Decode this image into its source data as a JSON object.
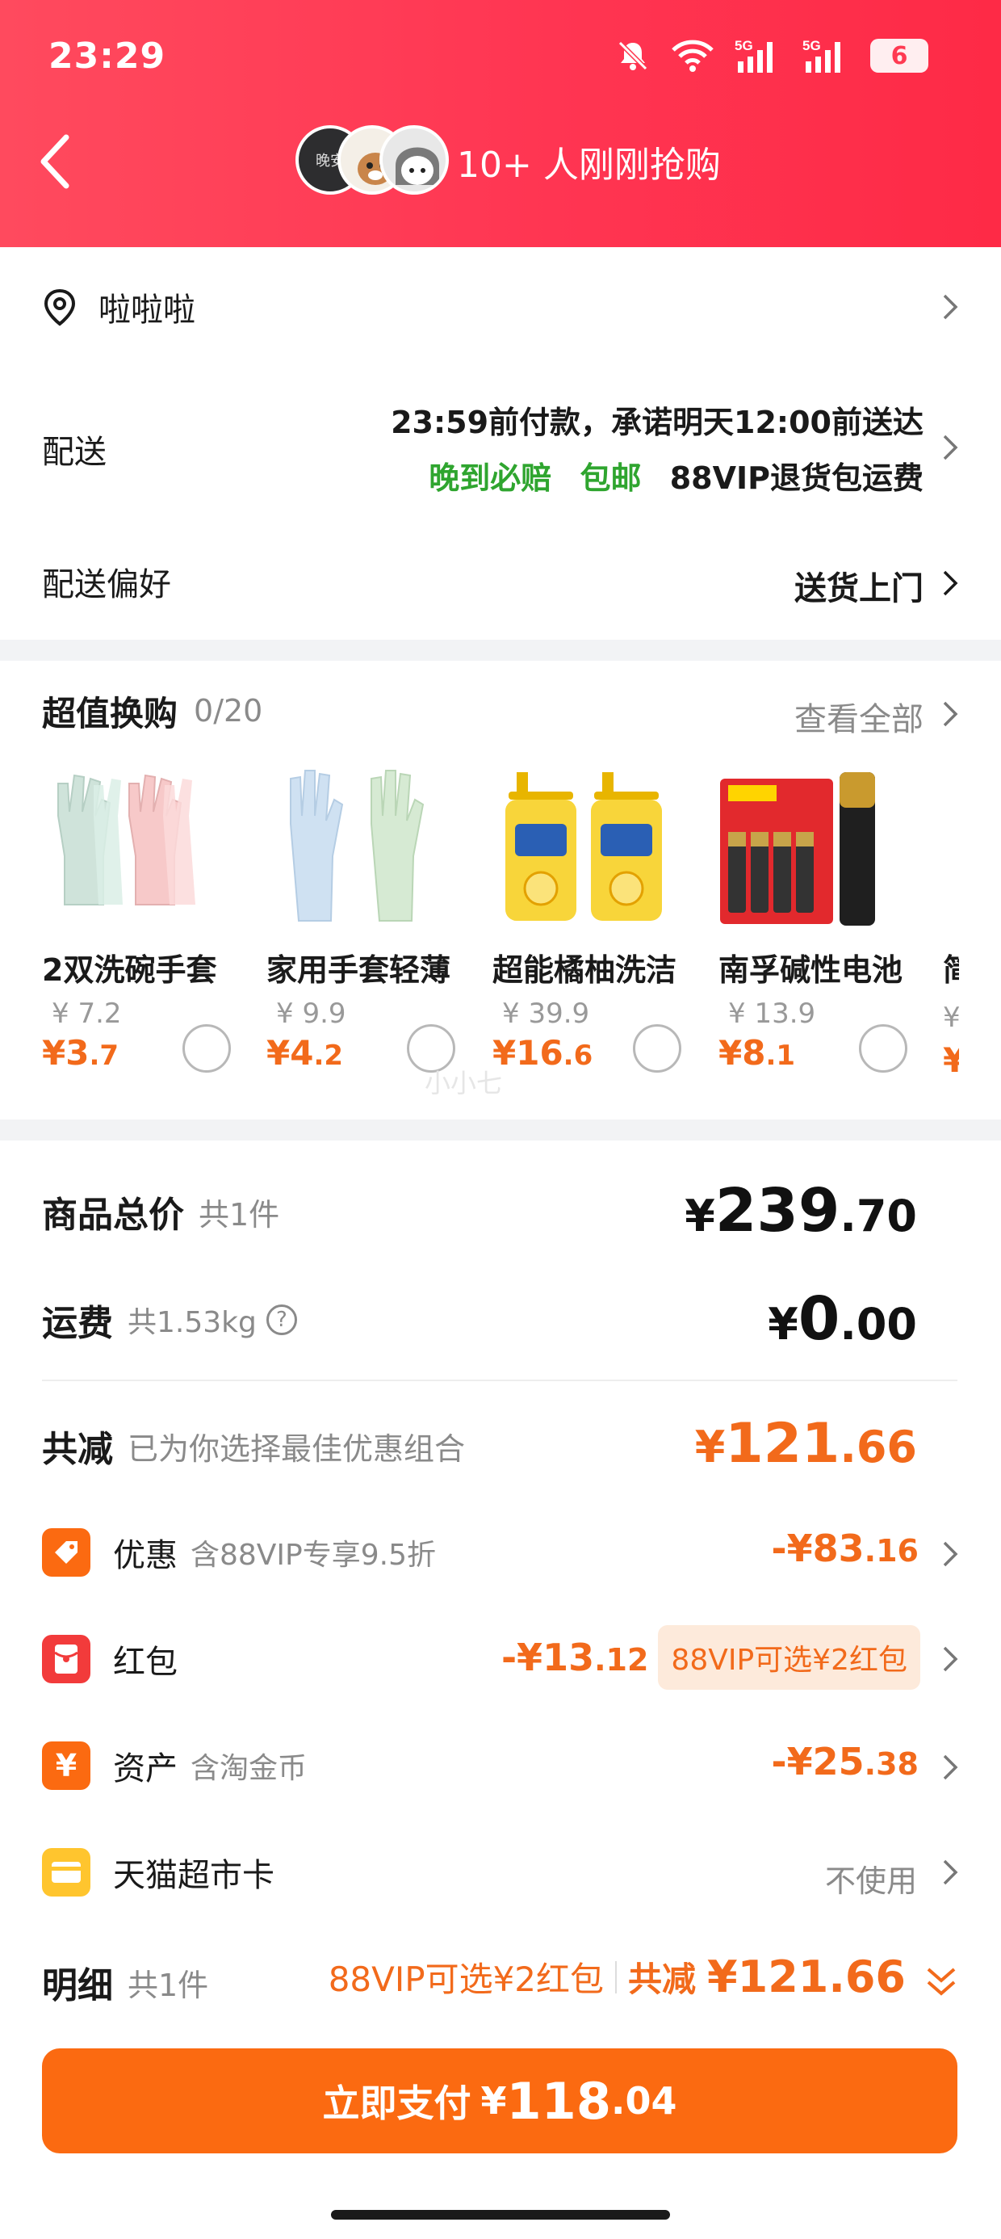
{
  "status_bar": {
    "time": "23:29",
    "battery": "6",
    "signal_label_1": "5G",
    "signal_label_2": "5G"
  },
  "header": {
    "hot_text": "10+ 人刚刚抢购",
    "avatar_1_text": "晚安"
  },
  "address": {
    "name": "啦啦啦"
  },
  "delivery": {
    "label": "配送",
    "line1": "23:59前付款，承诺明天12:00前送达",
    "tag_late": "晚到必赔",
    "tag_free": "包邮",
    "tag_return": "88VIP退货包运费"
  },
  "delivery_pref": {
    "label": "配送偏好",
    "value": "送货上门"
  },
  "upsell": {
    "title": "超值换购",
    "count": "0/20",
    "view_all": "查看全部",
    "products": [
      {
        "name": "2双洗碗手套",
        "old_price": "¥ 7.2",
        "price_int": "¥3",
        "price_dec": ".7"
      },
      {
        "name": "家用手套轻薄",
        "old_price": "¥ 9.9",
        "price_int": "¥4",
        "price_dec": ".2"
      },
      {
        "name": "超能橘柚洗洁",
        "old_price": "¥ 39.9",
        "price_int": "¥16",
        "price_dec": ".6"
      },
      {
        "name": "南孚碱性电池",
        "old_price": "¥ 13.9",
        "price_int": "¥8",
        "price_dec": ".1"
      },
      {
        "name": "简",
        "old_price": "¥",
        "price_int": "¥",
        "price_dec": ""
      }
    ],
    "watermark": "小小七"
  },
  "summary": {
    "total_label": "商品总价",
    "total_count": "共1件",
    "total_int": "239",
    "total_dec": ".70",
    "shipping_label": "运费",
    "shipping_weight": "共1.53kg",
    "shipping_int": "0",
    "shipping_dec": ".00",
    "reduce_label": "共减",
    "reduce_desc": "已为你选择最佳优惠组合",
    "reduce_int": "121",
    "reduce_dec": ".66",
    "currency": "¥"
  },
  "discounts": [
    {
      "label": "优惠",
      "desc": "含88VIP专享9.5折",
      "amount_int": "-¥83",
      "amount_dec": ".16"
    },
    {
      "label": "红包",
      "desc": "",
      "amount_int": "-¥13",
      "amount_dec": ".12",
      "badge": "88VIP可选¥2红包"
    },
    {
      "label": "资产",
      "desc": "含淘金币",
      "amount_int": "-¥25",
      "amount_dec": ".38",
      "icon_char": "¥"
    },
    {
      "label": "天猫超市卡",
      "desc": "",
      "value": "不使用"
    }
  ],
  "detail": {
    "label": "明细",
    "count": "共1件",
    "vip_text": "88VIP可选¥2红包",
    "reduce_label": "共减",
    "reduce_amount": "¥121.66"
  },
  "pay_button": {
    "label": "立即支付",
    "currency": "¥",
    "amount_int": "118",
    "amount_dec": ".04"
  },
  "colors": {
    "header_red": "#ff3a52",
    "accent_orange": "#fb6a11",
    "green": "#2fa52f"
  }
}
